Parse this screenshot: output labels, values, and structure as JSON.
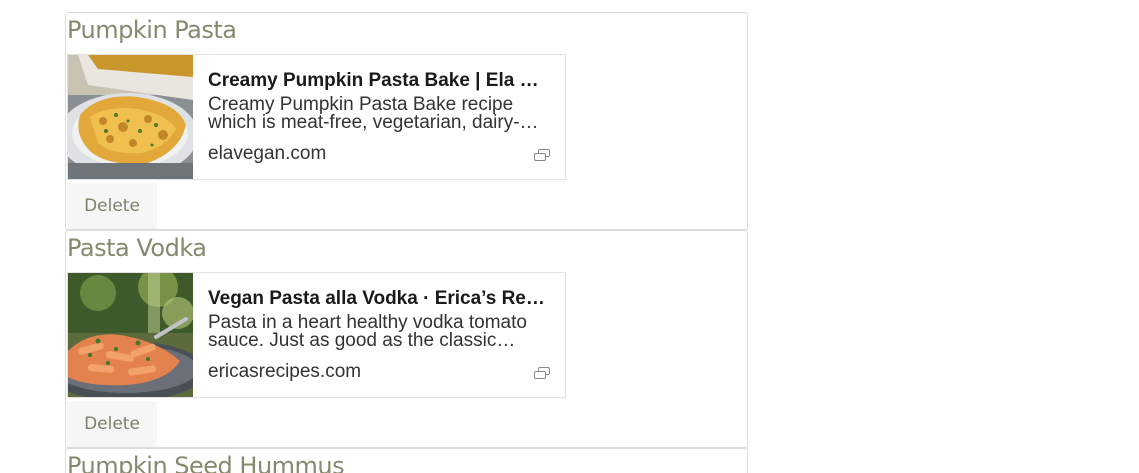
{
  "recipes": [
    {
      "title": "Pumpkin Pasta",
      "preview": {
        "title": "Creamy Pumpkin Pasta Bake | Ela Vegan",
        "description": "Creamy Pumpkin Pasta Bake recipe which is meat-free, vegetarian, dairy-free and easy to make.",
        "domain": "elavegan.com",
        "image_icon": "pumpkin-pasta-bake-photo"
      },
      "delete_label": "Delete"
    },
    {
      "title": "Pasta Vodka",
      "preview": {
        "title": "Vegan Pasta alla Vodka · Erica’s Recipes",
        "description": "Pasta in a heart healthy vodka tomato sauce. Just as good as the classic version.",
        "domain": "ericasrecipes.com",
        "image_icon": "pasta-vodka-photo"
      },
      "delete_label": "Delete"
    },
    {
      "title": "Pumpkin Seed Hummus"
    }
  ],
  "link_icon": "external-link-icon",
  "colors": {
    "title": "#87896f",
    "delete_text": "#7d7f69",
    "delete_bg": "#f6f6f6",
    "border": "#dcdcdc"
  }
}
